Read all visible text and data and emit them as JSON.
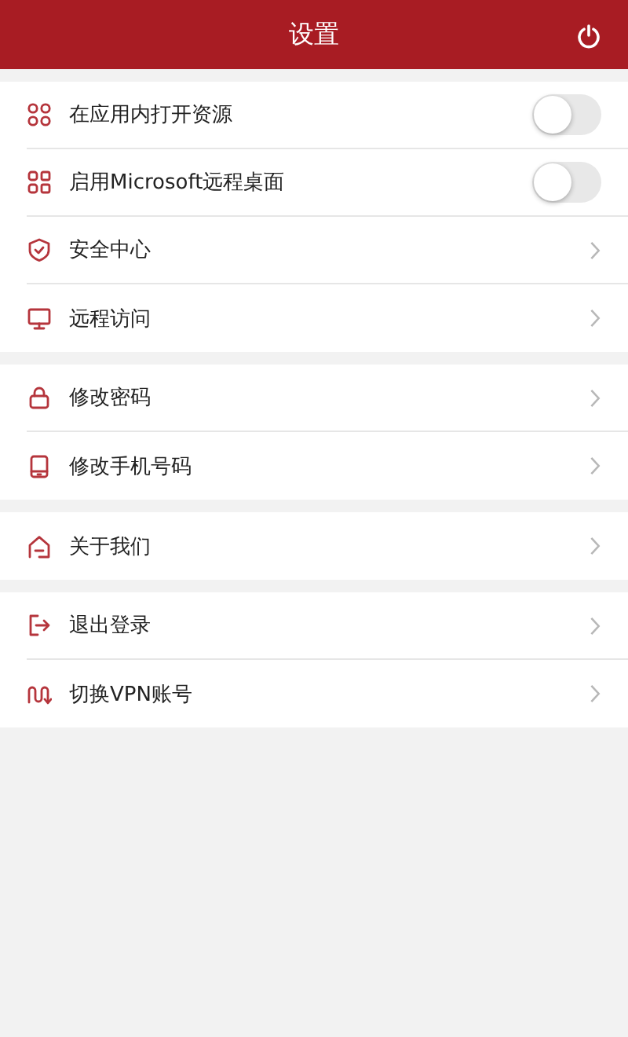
{
  "header": {
    "title": "设置"
  },
  "groups": [
    {
      "items": [
        {
          "kind": "toggle",
          "label": "在应用内打开资源",
          "on": false
        },
        {
          "kind": "toggle",
          "label": "启用Microsoft远程桌面",
          "on": false
        },
        {
          "kind": "link",
          "label": "安全中心"
        },
        {
          "kind": "link",
          "label": "远程访问"
        }
      ]
    },
    {
      "items": [
        {
          "kind": "link",
          "label": "修改密码"
        },
        {
          "kind": "link",
          "label": "修改手机号码"
        }
      ]
    },
    {
      "items": [
        {
          "kind": "link",
          "label": "关于我们"
        }
      ]
    },
    {
      "items": [
        {
          "kind": "link",
          "label": "退出登录"
        },
        {
          "kind": "link",
          "label": "切换VPN账号"
        }
      ]
    }
  ]
}
